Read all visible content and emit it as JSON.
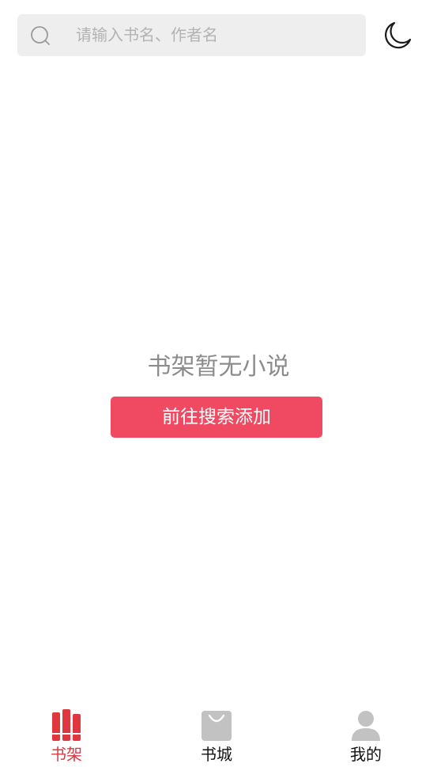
{
  "search": {
    "placeholder": "请输入书名、作者名"
  },
  "header": {
    "theme_toggle_icon": "moon-icon"
  },
  "empty_state": {
    "message": "书架暂无小说",
    "button_label": "前往搜索添加"
  },
  "tabbar": {
    "tabs": [
      {
        "label": "书架",
        "icon": "bookshelf-icon",
        "active": true
      },
      {
        "label": "书城",
        "icon": "shopping-bag-icon",
        "active": false
      },
      {
        "label": "我的",
        "icon": "user-icon",
        "active": false
      }
    ]
  },
  "colors": {
    "accent": "#ef4a62",
    "active_tab": "#e0363f",
    "search_bg": "#eeeeee",
    "placeholder": "#b3b3b3",
    "empty_text": "#8c8c8c",
    "inactive_icon": "#c2c2c2"
  }
}
